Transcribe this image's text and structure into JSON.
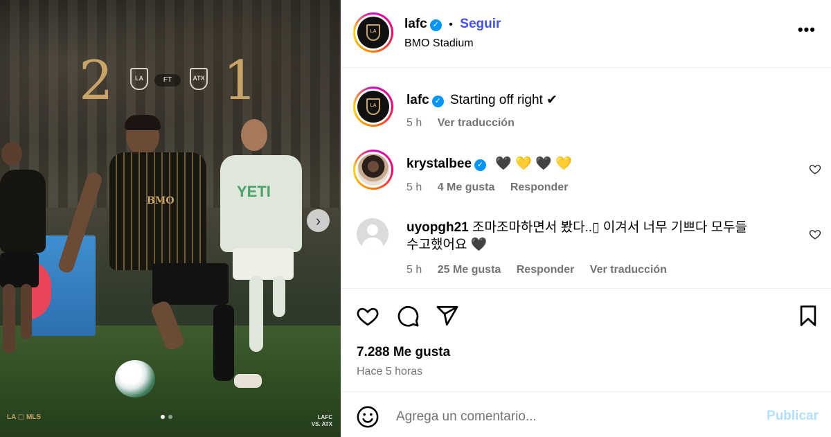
{
  "media": {
    "score_home": "2",
    "score_away": "1",
    "status": "FT",
    "home_crest": "LA",
    "away_crest": "ATX",
    "kit_sponsor": "BMO",
    "opponent_sponsor": "YETI",
    "corner_logos": "LA ▢ MLS",
    "matchup_line1": "LAFC",
    "matchup_line2": "VS. ATX",
    "next_icon": "chevron-right-icon",
    "slide_count": 2,
    "active_slide": 1
  },
  "header": {
    "username": "lafc",
    "separator": "•",
    "follow_label": "Seguir",
    "location": "BMO Stadium",
    "more_label": "•••"
  },
  "caption": {
    "username": "lafc",
    "text": "Starting off right ✔",
    "time": "5 h",
    "translate": "Ver traducción"
  },
  "comments": [
    {
      "username": "krystalbee",
      "text": "🖤 💛 🖤 💛",
      "time": "5 h",
      "likes": "4 Me gusta",
      "reply": "Responder"
    },
    {
      "username": "uyopgh21",
      "text_line1": "조마조마하면서 봤다..▯ 이겨서 너무 기쁘다 모두들",
      "text_line2": "수고했어요 🖤",
      "time": "5 h",
      "likes": "25 Me gusta",
      "reply": "Responder",
      "translate": "Ver traducción"
    }
  ],
  "stats": {
    "likes": "7.288 Me gusta",
    "time_ago": "Hace 5 horas"
  },
  "composer": {
    "placeholder": "Agrega un comentario...",
    "publish_label": "Publicar"
  },
  "colors": {
    "link_blue": "#4150f7",
    "publish_disabled": "#b2dffc",
    "verified_blue": "#0095f6",
    "lafc_gold": "#c8a366",
    "meta_gray": "#737373"
  }
}
